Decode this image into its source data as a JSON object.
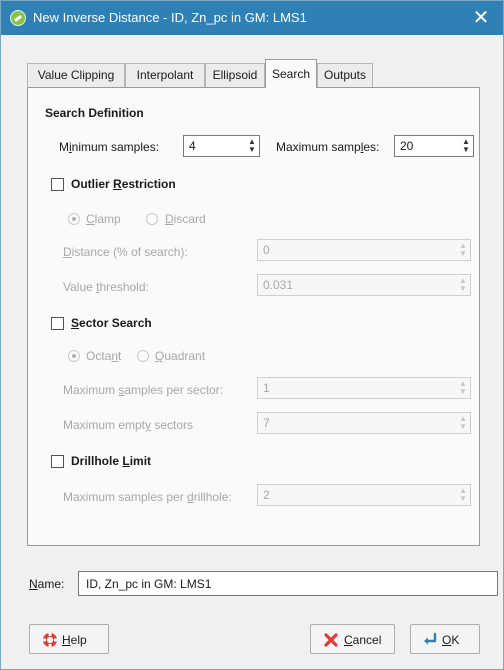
{
  "window": {
    "title": "New Inverse Distance - ID, Zn_pc in GM: LMS1",
    "close_glyph": "✕",
    "app_icon": "leapfrog-icon"
  },
  "tabs": [
    {
      "label": "Value Clipping",
      "active": false
    },
    {
      "label": "Interpolant",
      "active": false
    },
    {
      "label": "Ellipsoid",
      "active": false
    },
    {
      "label": "Search",
      "active": true
    },
    {
      "label": "Outputs",
      "active": false
    }
  ],
  "search": {
    "heading": "Search Definition",
    "min_samples": {
      "label_pre": "M",
      "label_u": "i",
      "label_post": "nimum samples:",
      "value": "4"
    },
    "max_samples": {
      "label_pre": "Maximum samp",
      "label_u": "l",
      "label_post": "es:",
      "value": "20"
    }
  },
  "outlier": {
    "label_pre": "Outlier ",
    "label_u": "R",
    "label_post": "estriction",
    "checked": false,
    "clamp": {
      "label_u": "C",
      "label_post": "lamp",
      "selected": true
    },
    "discard": {
      "label_u": "D",
      "label_post": "iscard",
      "selected": false
    },
    "distance": {
      "label_u": "D",
      "label_post": "istance (% of search):",
      "value": "0"
    },
    "threshold": {
      "label_pre": "Value ",
      "label_u": "t",
      "label_post": "hreshold:",
      "value": "0.031"
    }
  },
  "sector": {
    "label_u": "S",
    "label_post": "ector Search",
    "checked": false,
    "octant": {
      "label_pre": "Octa",
      "label_u": "n",
      "label_post": "t",
      "selected": true
    },
    "quadrant": {
      "label_u": "Q",
      "label_post": "uadrant",
      "selected": false
    },
    "max_per_sector": {
      "label_pre": "Maximum ",
      "label_u": "s",
      "label_post": "amples per sector:",
      "value": "1"
    },
    "max_empty": {
      "label_pre": "Maximum empt",
      "label_u": "y",
      "label_post": " sectors",
      "value": "7"
    }
  },
  "drillhole": {
    "label_pre": "Drillhole ",
    "label_u": "L",
    "label_post": "imit",
    "checked": false,
    "max_per_drillhole": {
      "label_pre": "Maximum samples per ",
      "label_u": "d",
      "label_post": "rillhole:",
      "value": "2"
    }
  },
  "name": {
    "label_u": "N",
    "label_post": "ame:",
    "value": "ID, Zn_pc in GM: LMS1"
  },
  "buttons": {
    "help": {
      "label_u": "H",
      "label_post": "elp"
    },
    "cancel": {
      "label_u": "C",
      "label_post": "ancel"
    },
    "ok": {
      "label_u": "O",
      "label_post": "K"
    }
  },
  "colors": {
    "titlebar": "#2f80b5",
    "accent": "#2f80b5",
    "disabled_text": "#a7a7a7"
  }
}
